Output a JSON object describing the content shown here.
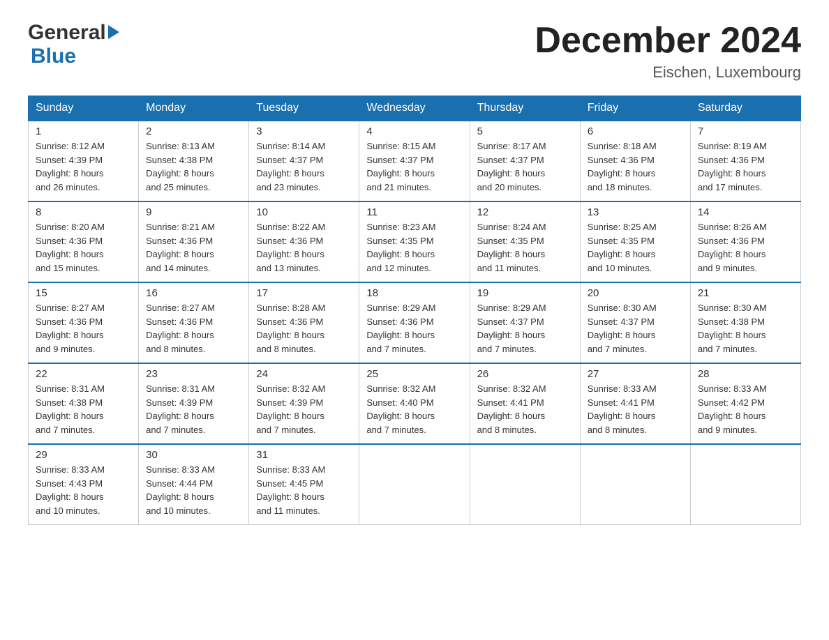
{
  "header": {
    "logo_general": "General",
    "logo_blue": "Blue",
    "month_title": "December 2024",
    "location": "Eischen, Luxembourg"
  },
  "days_of_week": [
    "Sunday",
    "Monday",
    "Tuesday",
    "Wednesday",
    "Thursday",
    "Friday",
    "Saturday"
  ],
  "weeks": [
    [
      {
        "day": "1",
        "sunrise": "8:12 AM",
        "sunset": "4:39 PM",
        "daylight": "8 hours and 26 minutes."
      },
      {
        "day": "2",
        "sunrise": "8:13 AM",
        "sunset": "4:38 PM",
        "daylight": "8 hours and 25 minutes."
      },
      {
        "day": "3",
        "sunrise": "8:14 AM",
        "sunset": "4:37 PM",
        "daylight": "8 hours and 23 minutes."
      },
      {
        "day": "4",
        "sunrise": "8:15 AM",
        "sunset": "4:37 PM",
        "daylight": "8 hours and 21 minutes."
      },
      {
        "day": "5",
        "sunrise": "8:17 AM",
        "sunset": "4:37 PM",
        "daylight": "8 hours and 20 minutes."
      },
      {
        "day": "6",
        "sunrise": "8:18 AM",
        "sunset": "4:36 PM",
        "daylight": "8 hours and 18 minutes."
      },
      {
        "day": "7",
        "sunrise": "8:19 AM",
        "sunset": "4:36 PM",
        "daylight": "8 hours and 17 minutes."
      }
    ],
    [
      {
        "day": "8",
        "sunrise": "8:20 AM",
        "sunset": "4:36 PM",
        "daylight": "8 hours and 15 minutes."
      },
      {
        "day": "9",
        "sunrise": "8:21 AM",
        "sunset": "4:36 PM",
        "daylight": "8 hours and 14 minutes."
      },
      {
        "day": "10",
        "sunrise": "8:22 AM",
        "sunset": "4:36 PM",
        "daylight": "8 hours and 13 minutes."
      },
      {
        "day": "11",
        "sunrise": "8:23 AM",
        "sunset": "4:35 PM",
        "daylight": "8 hours and 12 minutes."
      },
      {
        "day": "12",
        "sunrise": "8:24 AM",
        "sunset": "4:35 PM",
        "daylight": "8 hours and 11 minutes."
      },
      {
        "day": "13",
        "sunrise": "8:25 AM",
        "sunset": "4:35 PM",
        "daylight": "8 hours and 10 minutes."
      },
      {
        "day": "14",
        "sunrise": "8:26 AM",
        "sunset": "4:36 PM",
        "daylight": "8 hours and 9 minutes."
      }
    ],
    [
      {
        "day": "15",
        "sunrise": "8:27 AM",
        "sunset": "4:36 PM",
        "daylight": "8 hours and 9 minutes."
      },
      {
        "day": "16",
        "sunrise": "8:27 AM",
        "sunset": "4:36 PM",
        "daylight": "8 hours and 8 minutes."
      },
      {
        "day": "17",
        "sunrise": "8:28 AM",
        "sunset": "4:36 PM",
        "daylight": "8 hours and 8 minutes."
      },
      {
        "day": "18",
        "sunrise": "8:29 AM",
        "sunset": "4:36 PM",
        "daylight": "8 hours and 7 minutes."
      },
      {
        "day": "19",
        "sunrise": "8:29 AM",
        "sunset": "4:37 PM",
        "daylight": "8 hours and 7 minutes."
      },
      {
        "day": "20",
        "sunrise": "8:30 AM",
        "sunset": "4:37 PM",
        "daylight": "8 hours and 7 minutes."
      },
      {
        "day": "21",
        "sunrise": "8:30 AM",
        "sunset": "4:38 PM",
        "daylight": "8 hours and 7 minutes."
      }
    ],
    [
      {
        "day": "22",
        "sunrise": "8:31 AM",
        "sunset": "4:38 PM",
        "daylight": "8 hours and 7 minutes."
      },
      {
        "day": "23",
        "sunrise": "8:31 AM",
        "sunset": "4:39 PM",
        "daylight": "8 hours and 7 minutes."
      },
      {
        "day": "24",
        "sunrise": "8:32 AM",
        "sunset": "4:39 PM",
        "daylight": "8 hours and 7 minutes."
      },
      {
        "day": "25",
        "sunrise": "8:32 AM",
        "sunset": "4:40 PM",
        "daylight": "8 hours and 7 minutes."
      },
      {
        "day": "26",
        "sunrise": "8:32 AM",
        "sunset": "4:41 PM",
        "daylight": "8 hours and 8 minutes."
      },
      {
        "day": "27",
        "sunrise": "8:33 AM",
        "sunset": "4:41 PM",
        "daylight": "8 hours and 8 minutes."
      },
      {
        "day": "28",
        "sunrise": "8:33 AM",
        "sunset": "4:42 PM",
        "daylight": "8 hours and 9 minutes."
      }
    ],
    [
      {
        "day": "29",
        "sunrise": "8:33 AM",
        "sunset": "4:43 PM",
        "daylight": "8 hours and 10 minutes."
      },
      {
        "day": "30",
        "sunrise": "8:33 AM",
        "sunset": "4:44 PM",
        "daylight": "8 hours and 10 minutes."
      },
      {
        "day": "31",
        "sunrise": "8:33 AM",
        "sunset": "4:45 PM",
        "daylight": "8 hours and 11 minutes."
      },
      null,
      null,
      null,
      null
    ]
  ],
  "labels": {
    "sunrise": "Sunrise:",
    "sunset": "Sunset:",
    "daylight": "Daylight:"
  }
}
